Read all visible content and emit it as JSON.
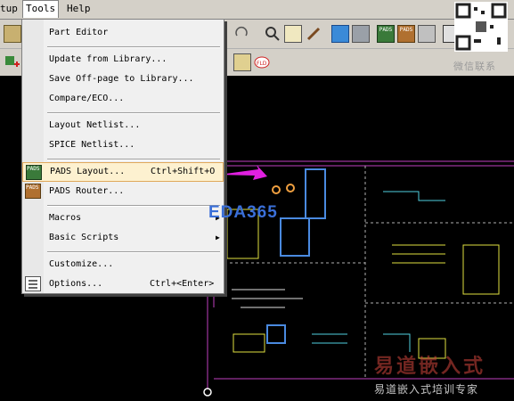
{
  "menubar": {
    "setup_partial": "tup",
    "tools": "Tools",
    "help": "Help"
  },
  "toolbar_icons": {
    "row1_left": "clipboard-icon",
    "row2_left": "add-component-icon",
    "pads_layout_icon_label": "PADS",
    "pads_router_icon_label": "PADS"
  },
  "tools_menu": {
    "items": [
      {
        "label": "Part Editor",
        "shortcut": ""
      },
      {
        "label": "Update from Library...",
        "shortcut": ""
      },
      {
        "label": "Save Off-page to Library...",
        "shortcut": ""
      },
      {
        "label": "Compare/ECO...",
        "shortcut": ""
      },
      {
        "label": "Layout Netlist...",
        "shortcut": ""
      },
      {
        "label": "SPICE Netlist...",
        "shortcut": ""
      },
      {
        "label": "PADS Layout...",
        "shortcut": "Ctrl+Shift+O"
      },
      {
        "label": "PADS Router...",
        "shortcut": ""
      },
      {
        "label": "Macros",
        "shortcut": ""
      },
      {
        "label": "Basic Scripts",
        "shortcut": ""
      },
      {
        "label": "Customize...",
        "shortcut": ""
      },
      {
        "label": "Options...",
        "shortcut": "Ctrl+<Enter>"
      }
    ],
    "highlighted": "PADS Layout...",
    "menu_icon_label": "PADS"
  },
  "watermarks": {
    "qr_caption": "微信联系",
    "eda_logo": "EDA365",
    "cn_brand": "易道嵌入式",
    "cn_sub": "易道嵌入式培训专家"
  },
  "colors": {
    "ui_bg": "#d4d0c8",
    "canvas_bg": "#000000",
    "highlight": "#fdf1d0",
    "border_pink": "#c040c0",
    "arrow": "#e020e0"
  }
}
